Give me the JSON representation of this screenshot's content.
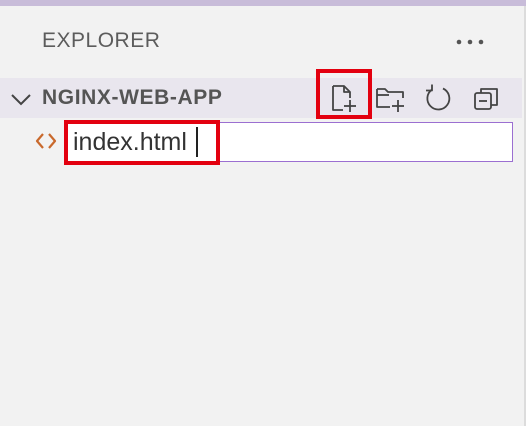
{
  "explorer": {
    "title": "EXPLORER",
    "more_icon": "ellipsis-icon"
  },
  "folder": {
    "name": "NGINX-WEB-APP",
    "expanded": true,
    "actions": [
      {
        "name": "new-file",
        "icon": "new-file-icon"
      },
      {
        "name": "new-folder",
        "icon": "new-folder-icon"
      },
      {
        "name": "refresh",
        "icon": "refresh-icon"
      },
      {
        "name": "collapse-all",
        "icon": "collapse-all-icon"
      }
    ]
  },
  "new_file_input": {
    "value": "index.html",
    "file_icon": "html-code-icon"
  },
  "colors": {
    "highlight": "#e3000f",
    "input_border": "#9b6fd1",
    "html_icon": "#c9692c",
    "header_bg": "#e9e6ee",
    "background": "#f2f2f2"
  }
}
